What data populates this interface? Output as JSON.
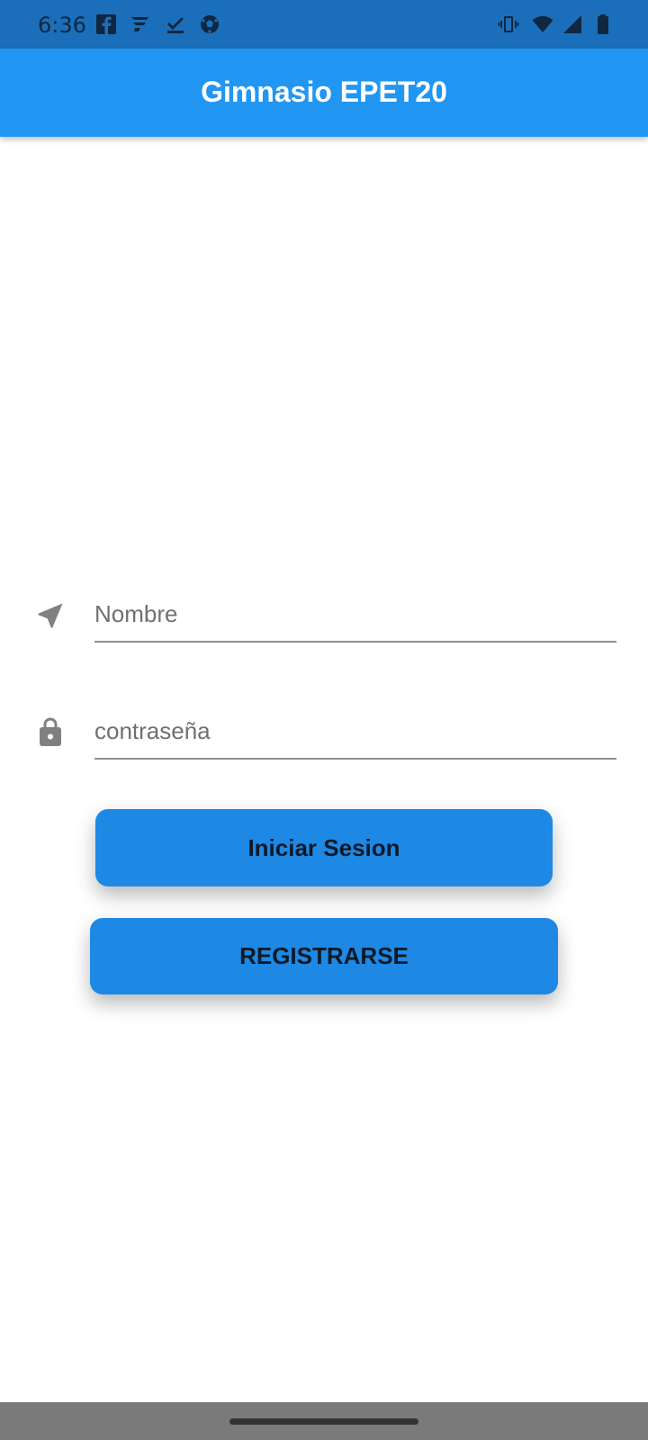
{
  "status_bar": {
    "time": "6:36",
    "left_icons": [
      "facebook-icon",
      "app-f-icon",
      "download-check-icon",
      "soccer-ball-icon"
    ],
    "right_icons": [
      "vibrate-icon",
      "wifi-icon",
      "signal-icon",
      "battery-icon"
    ]
  },
  "app_bar": {
    "title": "Gimnasio EPET20",
    "color": "#2196f3"
  },
  "form": {
    "name_field": {
      "icon": "navigation-arrow-icon",
      "placeholder": "Nombre",
      "value": ""
    },
    "password_field": {
      "icon": "lock-icon",
      "placeholder": "contraseña",
      "value": ""
    }
  },
  "buttons": {
    "login_label": "Iniciar Sesion",
    "register_label": "REGISTRARSE",
    "color": "#1e88e5"
  }
}
